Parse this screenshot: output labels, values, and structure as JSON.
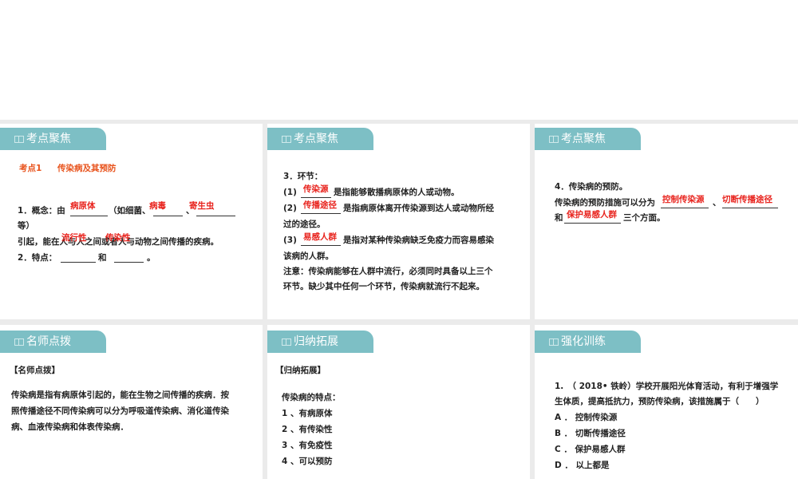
{
  "cards": {
    "c1": {
      "tab": "考点聚焦",
      "heading_num": "考点1",
      "heading_title": "传染病及其预防",
      "l1a": "1．概念：由",
      "l1b": "（如细菌、",
      "l1c": "、",
      "l2": "等）",
      "l3": "引起，能在人与人之间或者人与动物之间传播的疾病。",
      "l4a": "2．特点：",
      "l4b": "和",
      "l4c": "。",
      "ans": [
        "病原体",
        "病毒",
        "寄生虫",
        "流行性",
        "传染性"
      ]
    },
    "c2": {
      "tab": "考点聚焦",
      "title": "3．环节：",
      "i1": "(1)",
      "t1": "是指能够散播病原体的人或动物。",
      "i2": "(2)",
      "t2": "是指病原体离开传染源到达人或动物所经",
      "t2b": "过的途径。",
      "i3": "(3)",
      "t3": "是指对某种传染病缺乏免疫力而容易感染",
      "t3b": "该病的人群。",
      "n1": "注意：传染病能够在人群中流行，必须同时具备以上三个",
      "n2": "环节。缺少其中任何一个环节，传染病就流行不起来。",
      "ans": [
        "传染源",
        "传播途径",
        "易感人群"
      ]
    },
    "c3": {
      "tab": "考点聚焦",
      "title": "4．传染病的预防。",
      "l1": "传染病的预防措施可以分为",
      "sep": "、",
      "l2a": "和",
      "l2b": "三个方面。",
      "ans": [
        "控制传染源",
        "切断传播途径",
        "保护易感人群"
      ]
    },
    "c4": {
      "tab": "名师点拨",
      "heading": "【名师点拨】",
      "p": [
        "传染病是指有病原体引起的，能在生物之间传播的疾病．按",
        "照传播途径不同传染病可以分为呼吸道传染病、消化道传染",
        "病、血液传染病和体表传染病．"
      ]
    },
    "c5": {
      "tab": "归纳拓展",
      "heading": "【归纳拓展】",
      "intro": "传染病的特点：",
      "items": [
        "1 、有病原体",
        "2 、有传染性",
        "3 、有免疫性",
        "4 、可以预防"
      ]
    },
    "c6": {
      "tab": "强化训练",
      "q1": "1.　（ 2018• 铁岭）学校开展阳光体育活动，有利于增强学",
      "q2": "生体质，提高抵抗力，预防传染病，该措施属于（　　）",
      "options": [
        "A ． 控制传染源",
        "B ． 切断传播途径",
        "C ． 保护易感人群",
        "D ． 以上都是"
      ]
    }
  },
  "colors": {
    "tab": "#7dbfc5",
    "answer": "#e8221c"
  }
}
